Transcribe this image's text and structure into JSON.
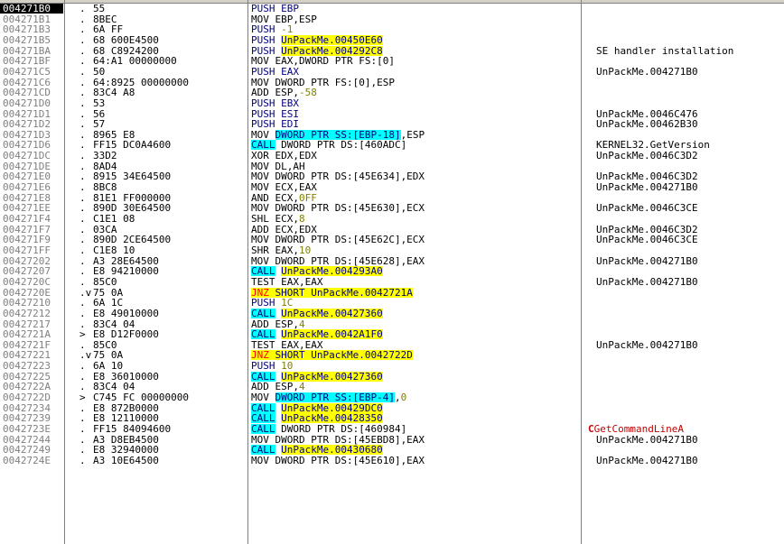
{
  "rows": [
    {
      "addr": "004271B0",
      "mark": ".",
      "hex": "55",
      "dis": [
        [
          "push",
          "PUSH EBP"
        ]
      ],
      "com": ""
    },
    {
      "addr": "004271B1",
      "mark": ".",
      "hex": "8BEC",
      "dis": [
        [
          "t",
          "MOV EBP,ESP"
        ]
      ],
      "com": ""
    },
    {
      "addr": "004271B3",
      "mark": ".",
      "hex": "6A FF",
      "dis": [
        [
          "push",
          "PUSH "
        ],
        [
          "num",
          "-1"
        ]
      ],
      "com": ""
    },
    {
      "addr": "004271B5",
      "mark": ".",
      "hex": "68 600E4500",
      "dis": [
        [
          "push",
          "PUSH "
        ],
        [
          "y",
          "UnPackMe.00450E60"
        ]
      ],
      "com": ""
    },
    {
      "addr": "004271BA",
      "mark": ".",
      "hex": "68 C8924200",
      "dis": [
        [
          "push",
          "PUSH "
        ],
        [
          "y",
          "UnPackMe.004292C8"
        ]
      ],
      "com": "SE handler installation"
    },
    {
      "addr": "004271BF",
      "mark": ".",
      "hex": "64:A1 00000000",
      "dis": [
        [
          "t",
          "MOV EAX,DWORD PTR FS:[0]"
        ]
      ],
      "com": ""
    },
    {
      "addr": "004271C5",
      "mark": ".",
      "hex": "50",
      "dis": [
        [
          "push",
          "PUSH EAX"
        ]
      ],
      "com": "UnPackMe.004271B0"
    },
    {
      "addr": "004271C6",
      "mark": ".",
      "hex": "64:8925 00000000",
      "dis": [
        [
          "t",
          "MOV DWORD PTR FS:[0],ESP"
        ]
      ],
      "com": ""
    },
    {
      "addr": "004271CD",
      "mark": ".",
      "hex": "83C4 A8",
      "dis": [
        [
          "t",
          "ADD ESP,"
        ],
        [
          "num",
          "-58"
        ]
      ],
      "com": ""
    },
    {
      "addr": "004271D0",
      "mark": ".",
      "hex": "53",
      "dis": [
        [
          "push",
          "PUSH EBX"
        ]
      ],
      "com": ""
    },
    {
      "addr": "004271D1",
      "mark": ".",
      "hex": "56",
      "dis": [
        [
          "push",
          "PUSH ESI"
        ]
      ],
      "com": "UnPackMe.0046C476"
    },
    {
      "addr": "004271D2",
      "mark": ".",
      "hex": "57",
      "dis": [
        [
          "push",
          "PUSH EDI"
        ]
      ],
      "com": "UnPackMe.00462B30"
    },
    {
      "addr": "004271D3",
      "mark": ".",
      "hex": "8965 E8",
      "dis": [
        [
          "t",
          "MOV "
        ],
        [
          "c",
          "DWORD PTR SS:[EBP-18]"
        ],
        [
          "t",
          ",ESP"
        ]
      ],
      "com": ""
    },
    {
      "addr": "004271D6",
      "mark": ".",
      "hex": "FF15 DC0A4600",
      "dis": [
        [
          "call",
          "CALL"
        ],
        [
          "t",
          " DWORD PTR DS:[460ADC]"
        ]
      ],
      "com": "KERNEL32.GetVersion"
    },
    {
      "addr": "004271DC",
      "mark": ".",
      "hex": "33D2",
      "dis": [
        [
          "t",
          "XOR EDX,EDX"
        ]
      ],
      "com": "UnPackMe.0046C3D2"
    },
    {
      "addr": "004271DE",
      "mark": ".",
      "hex": "8AD4",
      "dis": [
        [
          "t",
          "MOV DL,AH"
        ]
      ],
      "com": ""
    },
    {
      "addr": "004271E0",
      "mark": ".",
      "hex": "8915 34E64500",
      "dis": [
        [
          "t",
          "MOV DWORD PTR DS:[45E634],EDX"
        ]
      ],
      "com": "UnPackMe.0046C3D2"
    },
    {
      "addr": "004271E6",
      "mark": ".",
      "hex": "8BC8",
      "dis": [
        [
          "t",
          "MOV ECX,EAX"
        ]
      ],
      "com": "UnPackMe.004271B0"
    },
    {
      "addr": "004271E8",
      "mark": ".",
      "hex": "81E1 FF000000",
      "dis": [
        [
          "t",
          "AND ECX,"
        ],
        [
          "num",
          "0FF"
        ]
      ],
      "com": ""
    },
    {
      "addr": "004271EE",
      "mark": ".",
      "hex": "890D 30E64500",
      "dis": [
        [
          "t",
          "MOV DWORD PTR DS:[45E630],ECX"
        ]
      ],
      "com": "UnPackMe.0046C3CE"
    },
    {
      "addr": "004271F4",
      "mark": ".",
      "hex": "C1E1 08",
      "dis": [
        [
          "t",
          "SHL ECX,"
        ],
        [
          "num",
          "8"
        ]
      ],
      "com": ""
    },
    {
      "addr": "004271F7",
      "mark": ".",
      "hex": "03CA",
      "dis": [
        [
          "t",
          "ADD ECX,EDX"
        ]
      ],
      "com": "UnPackMe.0046C3D2"
    },
    {
      "addr": "004271F9",
      "mark": ".",
      "hex": "890D 2CE64500",
      "dis": [
        [
          "t",
          "MOV DWORD PTR DS:[45E62C],ECX"
        ]
      ],
      "com": "UnPackMe.0046C3CE"
    },
    {
      "addr": "004271FF",
      "mark": ".",
      "hex": "C1E8 10",
      "dis": [
        [
          "t",
          "SHR EAX,"
        ],
        [
          "num",
          "10"
        ]
      ],
      "com": ""
    },
    {
      "addr": "00427202",
      "mark": ".",
      "hex": "A3 28E64500",
      "dis": [
        [
          "t",
          "MOV DWORD PTR DS:[45E628],EAX"
        ]
      ],
      "com": "UnPackMe.004271B0"
    },
    {
      "addr": "00427207",
      "mark": ".",
      "hex": "E8 94210000",
      "dis": [
        [
          "call",
          "CALL"
        ],
        [
          "t",
          " "
        ],
        [
          "y",
          "UnPackMe.004293A0"
        ]
      ],
      "com": ""
    },
    {
      "addr": "0042720C",
      "mark": ".",
      "hex": "85C0",
      "dis": [
        [
          "t",
          "TEST EAX,EAX"
        ]
      ],
      "com": "UnPackMe.004271B0"
    },
    {
      "addr": "0042720E",
      "mark": ".v",
      "hex": "75 0A",
      "dis": [
        [
          "jmp",
          "JNZ"
        ],
        [
          "y",
          " SHORT UnPackMe.0042721A"
        ]
      ],
      "com": ""
    },
    {
      "addr": "00427210",
      "mark": ".",
      "hex": "6A 1C",
      "dis": [
        [
          "push",
          "PUSH "
        ],
        [
          "num",
          "1C"
        ]
      ],
      "com": ""
    },
    {
      "addr": "00427212",
      "mark": ".",
      "hex": "E8 49010000",
      "dis": [
        [
          "call",
          "CALL"
        ],
        [
          "t",
          " "
        ],
        [
          "y",
          "UnPackMe.00427360"
        ]
      ],
      "com": ""
    },
    {
      "addr": "00427217",
      "mark": ".",
      "hex": "83C4 04",
      "dis": [
        [
          "t",
          "ADD ESP,"
        ],
        [
          "num",
          "4"
        ]
      ],
      "com": ""
    },
    {
      "addr": "0042721A",
      "mark": ">",
      "hex": "E8 D12F0000",
      "dis": [
        [
          "call",
          "CALL"
        ],
        [
          "t",
          " "
        ],
        [
          "y",
          "UnPackMe.0042A1F0"
        ]
      ],
      "com": ""
    },
    {
      "addr": "0042721F",
      "mark": ".",
      "hex": "85C0",
      "dis": [
        [
          "t",
          "TEST EAX,EAX"
        ]
      ],
      "com": "UnPackMe.004271B0"
    },
    {
      "addr": "00427221",
      "mark": ".v",
      "hex": "75 0A",
      "dis": [
        [
          "jmp",
          "JNZ"
        ],
        [
          "y",
          " SHORT UnPackMe.0042722D"
        ]
      ],
      "com": ""
    },
    {
      "addr": "00427223",
      "mark": ".",
      "hex": "6A 10",
      "dis": [
        [
          "push",
          "PUSH "
        ],
        [
          "num",
          "10"
        ]
      ],
      "com": ""
    },
    {
      "addr": "00427225",
      "mark": ".",
      "hex": "E8 36010000",
      "dis": [
        [
          "call",
          "CALL"
        ],
        [
          "t",
          " "
        ],
        [
          "y",
          "UnPackMe.00427360"
        ]
      ],
      "com": ""
    },
    {
      "addr": "0042722A",
      "mark": ".",
      "hex": "83C4 04",
      "dis": [
        [
          "t",
          "ADD ESP,"
        ],
        [
          "num",
          "4"
        ]
      ],
      "com": ""
    },
    {
      "addr": "0042722D",
      "mark": ">",
      "hex": "C745 FC 00000000",
      "dis": [
        [
          "t",
          "MOV "
        ],
        [
          "c",
          "DWORD PTR SS:[EBP-4]"
        ],
        [
          "t",
          ","
        ],
        [
          "num",
          "0"
        ]
      ],
      "com": ""
    },
    {
      "addr": "00427234",
      "mark": ".",
      "hex": "E8 872B0000",
      "dis": [
        [
          "call",
          "CALL"
        ],
        [
          "t",
          " "
        ],
        [
          "y",
          "UnPackMe.00429DC0"
        ]
      ],
      "com": ""
    },
    {
      "addr": "00427239",
      "mark": ".",
      "hex": "E8 12110000",
      "dis": [
        [
          "call",
          "CALL"
        ],
        [
          "t",
          " "
        ],
        [
          "y",
          "UnPackMe.00428350"
        ]
      ],
      "com": ""
    },
    {
      "addr": "0042723E",
      "mark": ".",
      "hex": "FF15 84094600",
      "dis": [
        [
          "call",
          "CALL"
        ],
        [
          "t",
          " DWORD PTR DS:[460984]"
        ]
      ],
      "com": "GetCommandLineA",
      "comRed": true
    },
    {
      "addr": "00427244",
      "mark": ".",
      "hex": "A3 D8EB4500",
      "dis": [
        [
          "t",
          "MOV DWORD PTR DS:[45EBD8],EAX"
        ]
      ],
      "com": "UnPackMe.004271B0"
    },
    {
      "addr": "00427249",
      "mark": ".",
      "hex": "E8 32940000",
      "dis": [
        [
          "call",
          "CALL"
        ],
        [
          "t",
          " "
        ],
        [
          "y",
          "UnPackMe.00430680"
        ]
      ],
      "com": ""
    },
    {
      "addr": "0042724E",
      "mark": ".",
      "hex": "A3 10E64500",
      "dis": [
        [
          "t",
          "MOV DWORD PTR DS:[45E610],EAX"
        ]
      ],
      "com": "UnPackMe.004271B0"
    }
  ],
  "comment_prefix_mark": "C"
}
